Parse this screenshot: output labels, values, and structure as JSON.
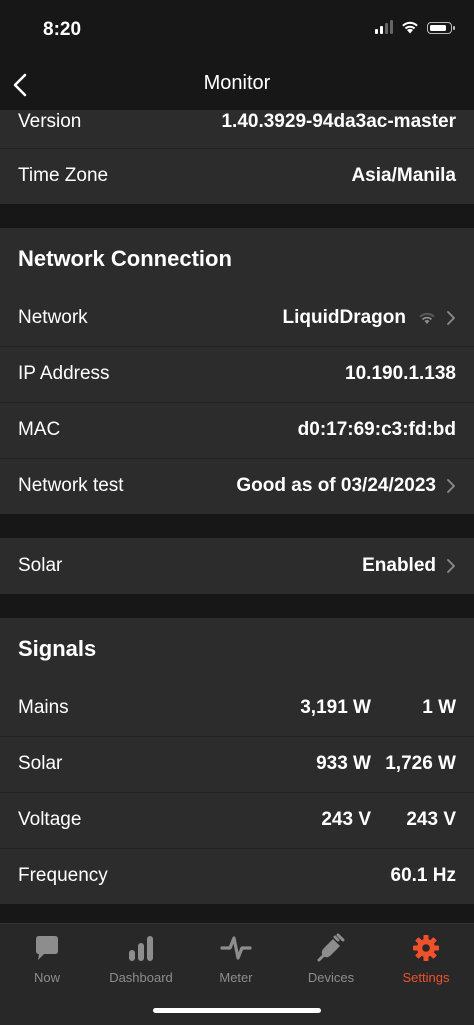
{
  "status_bar": {
    "time": "8:20"
  },
  "nav": {
    "title": "Monitor"
  },
  "info": {
    "version_label": "Version",
    "version_value": "1.40.3929-94da3ac-master",
    "timezone_label": "Time Zone",
    "timezone_value": "Asia/Manila"
  },
  "network": {
    "header": "Network Connection",
    "network_label": "Network",
    "network_value": "LiquidDragon",
    "ip_label": "IP Address",
    "ip_value": "10.190.1.138",
    "mac_label": "MAC",
    "mac_value": "d0:17:69:c3:fd:bd",
    "test_label": "Network test",
    "test_value": "Good as of 03/24/2023"
  },
  "solar": {
    "label": "Solar",
    "value": "Enabled"
  },
  "signals": {
    "header": "Signals",
    "mains_label": "Mains",
    "mains_v1": "3,191 W",
    "mains_v2": "1 W",
    "solar_label": "Solar",
    "solar_v1": "933 W",
    "solar_v2": "1,726 W",
    "voltage_label": "Voltage",
    "voltage_v1": "243 V",
    "voltage_v2": "243 V",
    "frequency_label": "Frequency",
    "frequency_value": "60.1 Hz"
  },
  "tabs": [
    {
      "label": "Now",
      "icon": "speech-bubble-icon"
    },
    {
      "label": "Dashboard",
      "icon": "bar-chart-icon"
    },
    {
      "label": "Meter",
      "icon": "pulse-icon"
    },
    {
      "label": "Devices",
      "icon": "plug-icon"
    },
    {
      "label": "Settings",
      "icon": "gear-icon"
    }
  ],
  "colors": {
    "accent": "#f0512a",
    "row_bg": "#2c2c2c",
    "page_bg": "#171717",
    "tab_inactive": "#8d8d8d"
  }
}
